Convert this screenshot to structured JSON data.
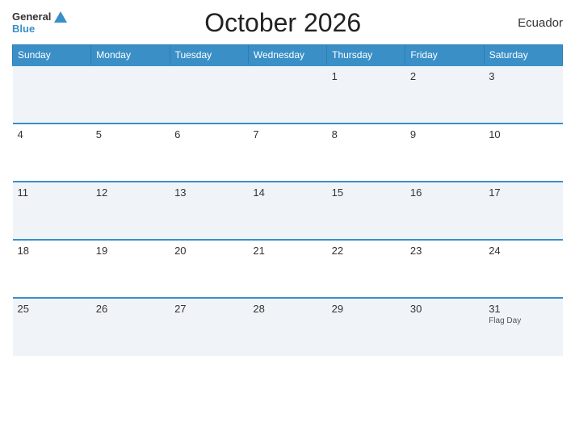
{
  "header": {
    "logo_general": "General",
    "logo_blue": "Blue",
    "title": "October 2026",
    "country": "Ecuador"
  },
  "days_of_week": [
    "Sunday",
    "Monday",
    "Tuesday",
    "Wednesday",
    "Thursday",
    "Friday",
    "Saturday"
  ],
  "weeks": [
    [
      {
        "num": "",
        "event": ""
      },
      {
        "num": "",
        "event": ""
      },
      {
        "num": "",
        "event": ""
      },
      {
        "num": "",
        "event": ""
      },
      {
        "num": "1",
        "event": ""
      },
      {
        "num": "2",
        "event": ""
      },
      {
        "num": "3",
        "event": ""
      }
    ],
    [
      {
        "num": "4",
        "event": ""
      },
      {
        "num": "5",
        "event": ""
      },
      {
        "num": "6",
        "event": ""
      },
      {
        "num": "7",
        "event": ""
      },
      {
        "num": "8",
        "event": ""
      },
      {
        "num": "9",
        "event": ""
      },
      {
        "num": "10",
        "event": ""
      }
    ],
    [
      {
        "num": "11",
        "event": ""
      },
      {
        "num": "12",
        "event": ""
      },
      {
        "num": "13",
        "event": ""
      },
      {
        "num": "14",
        "event": ""
      },
      {
        "num": "15",
        "event": ""
      },
      {
        "num": "16",
        "event": ""
      },
      {
        "num": "17",
        "event": ""
      }
    ],
    [
      {
        "num": "18",
        "event": ""
      },
      {
        "num": "19",
        "event": ""
      },
      {
        "num": "20",
        "event": ""
      },
      {
        "num": "21",
        "event": ""
      },
      {
        "num": "22",
        "event": ""
      },
      {
        "num": "23",
        "event": ""
      },
      {
        "num": "24",
        "event": ""
      }
    ],
    [
      {
        "num": "25",
        "event": ""
      },
      {
        "num": "26",
        "event": ""
      },
      {
        "num": "27",
        "event": ""
      },
      {
        "num": "28",
        "event": ""
      },
      {
        "num": "29",
        "event": ""
      },
      {
        "num": "30",
        "event": ""
      },
      {
        "num": "31",
        "event": "Flag Day"
      }
    ]
  ]
}
